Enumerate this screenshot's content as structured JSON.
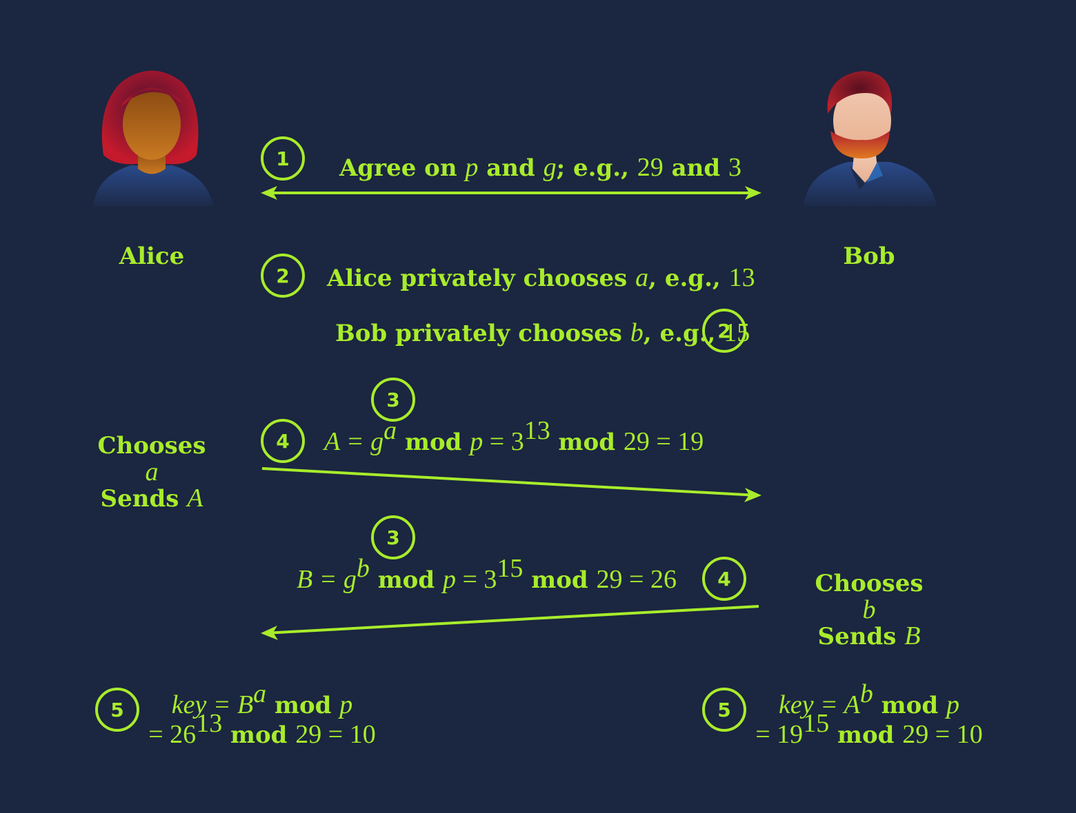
{
  "colors": {
    "background": "#1b2640",
    "accent": "#a8ec2b"
  },
  "people": {
    "alice": "Alice",
    "bob": "Bob"
  },
  "steps": {
    "s1": "1",
    "s2a": "2",
    "s2b": "2",
    "s3a": "3",
    "s4a": "4",
    "s3b": "3",
    "s4b": "4",
    "s5a": "5",
    "s5b": "5"
  },
  "step1": {
    "t1": "Agree on ",
    "p": "p",
    "t2": " and ",
    "g": "g",
    "t3": "; e.g., ",
    "n29": "29",
    "t4": " and ",
    "n3": "3"
  },
  "step2_alice": {
    "t1": "Alice privately chooses ",
    "a": "a",
    "t2": ", e.g., ",
    "n": "13"
  },
  "step2_bob": {
    "t1": "Bob privately chooses ",
    "b": "b",
    "t2": ", e.g., ",
    "n": "15"
  },
  "alice_action": {
    "line1": "Chooses",
    "var": "a",
    "line3": "Sends ",
    "A": "A"
  },
  "bob_action": {
    "line1": "Chooses",
    "var": "b",
    "line3": "Sends ",
    "B": "B"
  },
  "eqA": {
    "lhs": "A = g",
    "exp": "a",
    "mod": " mod ",
    "p": "p",
    "eq": " = 3",
    "exp2": "13",
    "mod2": " mod ",
    "rest": "29 = 19"
  },
  "eqB": {
    "lhs": "B = g",
    "exp": "b",
    "mod": " mod ",
    "p": "p",
    "eq": " = 3",
    "exp2": "15",
    "mod2": " mod ",
    "rest": "29 = 26"
  },
  "keyA": {
    "lhs": "key = B",
    "exp": "a",
    "mod": " mod ",
    "p": "p",
    "l2a": "= 26",
    "exp2": "13",
    "mod2": " mod ",
    "rest": "29 = 10"
  },
  "keyB": {
    "lhs": "key = A",
    "exp": "b",
    "mod": " mod ",
    "p": "p",
    "l2a": "= 19",
    "exp2": "15",
    "mod2": " mod ",
    "rest": "29 = 10"
  }
}
